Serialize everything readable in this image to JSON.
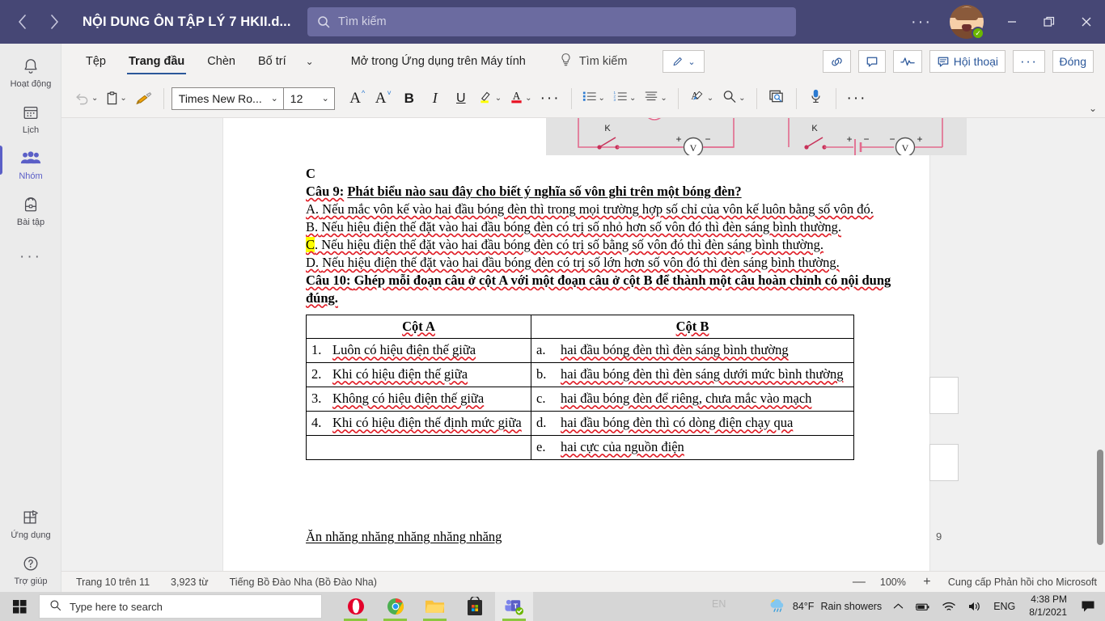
{
  "titlebar": {
    "back_icon": "chevron-left-icon",
    "forward_icon": "chevron-right-icon",
    "document_title": "NỘI DUNG ÔN TẬP LÝ 7 HKII.d...",
    "search_placeholder": "Tìm kiếm",
    "more_label": "···",
    "minimize_label": "—",
    "restore_label": "❐",
    "close_label": "✕",
    "accent_color": "#464775",
    "presence_color": "#6bb700"
  },
  "rail": {
    "items": [
      {
        "label": "Hoạt động",
        "icon": "bell-icon",
        "active": false
      },
      {
        "label": "Lịch",
        "icon": "calendar-icon",
        "active": false
      },
      {
        "label": "Nhóm",
        "icon": "people-icon",
        "active": true
      },
      {
        "label": "Bài tập",
        "icon": "backpack-icon",
        "active": false
      }
    ],
    "more_label": "···",
    "bottom_items": [
      {
        "label": "Ứng dụng",
        "icon": "apps-icon"
      },
      {
        "label": "Trợ giúp",
        "icon": "help-circle-icon"
      }
    ]
  },
  "ribbon": {
    "tabs": [
      {
        "label": "Tệp",
        "active": false
      },
      {
        "label": "Trang đầu",
        "active": true
      },
      {
        "label": "Chèn",
        "active": false
      },
      {
        "label": "Bố trí",
        "active": false
      }
    ],
    "tabs_overflow_icon": "chevron-down-icon",
    "open_in_app": "Mở trong Ứng dụng trên Máy tính",
    "tell_me": "Tìm kiếm",
    "tell_me_icon": "lightbulb-icon",
    "editing_icon": "pencil-icon",
    "right_buttons": [
      {
        "label": "",
        "icon": "link-icon",
        "name": "copy-link-button"
      },
      {
        "label": "",
        "icon": "comment-icon",
        "name": "comments-button"
      },
      {
        "label": "",
        "icon": "activity-icon",
        "name": "activity-button"
      },
      {
        "label": "Hội thoại",
        "icon": "conversation-icon",
        "name": "conversation-button"
      },
      {
        "label": "···",
        "icon": "",
        "name": "more-options-button"
      },
      {
        "label": "Đóng",
        "icon": "",
        "name": "close-doc-button"
      }
    ],
    "format": {
      "undo_icon": "undo-icon",
      "paste_icon": "paste-icon",
      "format_painter_icon": "format-painter-icon",
      "font_family": "Times New Ro...",
      "font_size": "12",
      "grow_font": "A",
      "shrink_font": "A",
      "bold": "B",
      "italic": "I",
      "underline": "U",
      "highlight_icon": "highlight-icon",
      "font_color_icon": "font-color-icon",
      "more_font_label": "···",
      "bullets_icon": "bullet-list-icon",
      "numbering_icon": "numbered-list-icon",
      "align_icon": "align-icon",
      "styles_icon": "styles-icon",
      "find_icon": "find-icon",
      "immersive_reader_icon": "immersive-reader-icon",
      "dictate_icon": "microphone-icon",
      "overflow_label": "···",
      "collapse_icon": "chevron-down-icon"
    }
  },
  "document": {
    "answer_marker": "C",
    "q9_label": "Câu 9:",
    "q9_title": "Phát biểu nào sau đây cho biết ý nghĩa số vôn ghi trên một bóng đèn?",
    "q9_options": [
      {
        "letter": "A.",
        "highlighted": false,
        "text": "Nếu mắc vôn kế vào hai đầu bóng đèn thì trong mọi trường hợp số chỉ của vôn kế luôn bằng số vôn đó."
      },
      {
        "letter": "B.",
        "highlighted": false,
        "text": "Nếu hiệu điện thế đặt vào hai đầu bóng đèn có trị số nhỏ hơn số vôn đó thì đèn sáng bình thường."
      },
      {
        "letter": "C",
        "highlighted": true,
        "text": ". Nếu hiệu điện thế đặt vào hai đầu bóng đèn có trị số bằng số vôn đó thì đèn sáng bình thường."
      },
      {
        "letter": "D.",
        "highlighted": false,
        "text": "Nếu hiệu điện thế đặt vào hai đầu bóng đèn có trị số lớn hơn số vôn đó thì đèn sáng bình thường."
      }
    ],
    "q10_label": "Câu 10:",
    "q10_title": "Ghép mỗi đoạn câu ở cột A với một đoạn câu ở cột B để thành một câu hoàn chỉnh có nội dung đúng.",
    "table": {
      "headers": [
        "Cột A",
        "Cột B"
      ],
      "rows": [
        {
          "a_num": "1.",
          "a_text": "Luôn có hiệu điện thế giữa",
          "b_num": "a.",
          "b_text": "hai đầu bóng đèn thì đèn sáng bình thường"
        },
        {
          "a_num": "2.",
          "a_text": "Khi có hiệu điện thế giữa",
          "b_num": "b.",
          "b_text": "hai đầu bóng đèn thì đèn sáng dưới mức bình thường"
        },
        {
          "a_num": "3.",
          "a_text": "Không có hiệu điện thế giữa",
          "b_num": "c.",
          "b_text": "hai đầu bóng đèn để riêng, chưa mắc vào mạch"
        },
        {
          "a_num": "4.",
          "a_text": "Khi có hiệu điện thế định mức giữa",
          "b_num": "d.",
          "b_text": "hai đầu bóng đèn thì có dòng điện chạy qua"
        },
        {
          "a_num": "",
          "a_text": "",
          "b_num": "e.",
          "b_text": "hai cực của nguồn điện"
        }
      ]
    },
    "trailing_text": "Ăn nhăng nhăng nhăng nhăng nhăng",
    "figure": {
      "switch_label_left": "K",
      "switch_label_right": "K",
      "meter_label_left": "V",
      "meter_label_right": "V",
      "plus": "+",
      "minus": "−",
      "line_color": "#e26a8d"
    },
    "page_number_marker": "9"
  },
  "statusbar": {
    "page_info": "Trang 10 trên 11",
    "word_count": "3,923 từ",
    "language": "Tiếng Bồ Đào Nha (Bồ Đào Nha)",
    "zoom_out": "—",
    "zoom_level": "100%",
    "zoom_in": "+",
    "feedback": "Cung cấp Phản hồi cho Microsoft"
  },
  "taskbar": {
    "start_icon": "windows-icon",
    "search_icon": "search-icon",
    "search_placeholder": "Type here to search",
    "apps": [
      {
        "name": "opera-icon",
        "running": true,
        "active": false
      },
      {
        "name": "chrome-icon",
        "running": true,
        "active": false
      },
      {
        "name": "file-explorer-icon",
        "running": true,
        "active": false
      },
      {
        "name": "microsoft-store-icon",
        "running": false,
        "active": false
      },
      {
        "name": "microsoft-teams-icon",
        "running": true,
        "active": true
      }
    ],
    "ime_indicator": "EN",
    "weather_temp": "84°F",
    "weather_desc": "Rain showers",
    "tray_chevron": "show-hidden-icons",
    "battery_icon": "battery-icon",
    "wifi_icon": "wifi-icon",
    "volume_icon": "volume-icon",
    "keyboard_lang": "ENG",
    "clock_time": "4:38 PM",
    "clock_date": "8/1/2021",
    "action_center_icon": "action-center-icon"
  }
}
